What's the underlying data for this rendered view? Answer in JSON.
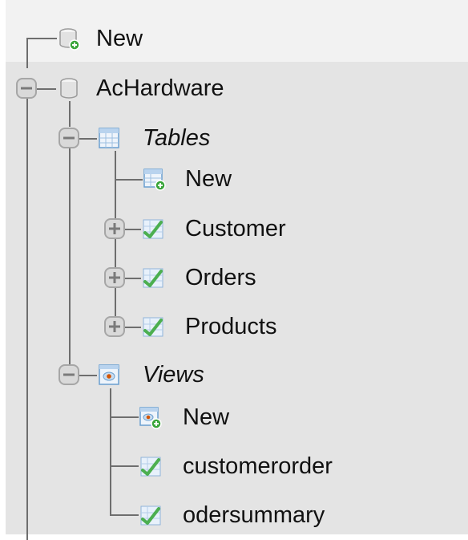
{
  "tree": {
    "new_db_label": "New",
    "database": {
      "name": "AcHardware",
      "tables": {
        "label": "Tables",
        "new_label": "New",
        "items": [
          "Customer",
          "Orders",
          "Products"
        ]
      },
      "views": {
        "label": "Views",
        "new_label": "New",
        "items": [
          "customerorder",
          "odersummary"
        ]
      }
    }
  },
  "colors": {
    "top_band": "#f2f2f2",
    "main_panel": "#e4e4e4",
    "connector": "#6e6e6e",
    "table_icon_check": "#4caf50",
    "new_badge": "#3aa53a"
  }
}
